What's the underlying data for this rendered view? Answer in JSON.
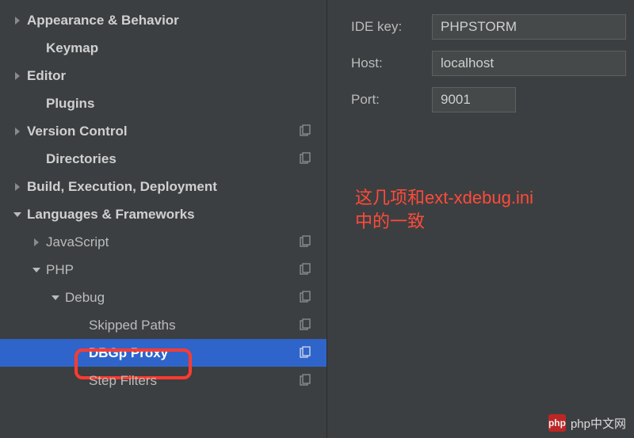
{
  "sidebar": {
    "items": [
      {
        "label": "Appearance & Behavior",
        "bold": true,
        "indent": 0,
        "arrow": "right",
        "copy": false
      },
      {
        "label": "Keymap",
        "bold": true,
        "indent": 1,
        "arrow": "none",
        "copy": false
      },
      {
        "label": "Editor",
        "bold": true,
        "indent": 0,
        "arrow": "right",
        "copy": false
      },
      {
        "label": "Plugins",
        "bold": true,
        "indent": 1,
        "arrow": "none",
        "copy": false
      },
      {
        "label": "Version Control",
        "bold": true,
        "indent": 0,
        "arrow": "right",
        "copy": true
      },
      {
        "label": "Directories",
        "bold": true,
        "indent": 1,
        "arrow": "none",
        "copy": true
      },
      {
        "label": "Build, Execution, Deployment",
        "bold": true,
        "indent": 0,
        "arrow": "right",
        "copy": false
      },
      {
        "label": "Languages & Frameworks",
        "bold": true,
        "indent": 0,
        "arrow": "down",
        "copy": false
      },
      {
        "label": "JavaScript",
        "bold": false,
        "indent": 1,
        "arrow": "right",
        "copy": true
      },
      {
        "label": "PHP",
        "bold": false,
        "indent": 1,
        "arrow": "down",
        "copy": true
      },
      {
        "label": "Debug",
        "bold": false,
        "indent": 2,
        "arrow": "down",
        "copy": true
      },
      {
        "label": "Skipped Paths",
        "bold": false,
        "indent": 3,
        "arrow": "none",
        "copy": true
      },
      {
        "label": "DBGp Proxy",
        "bold": false,
        "indent": 3,
        "arrow": "none",
        "copy": true,
        "selected": true
      },
      {
        "label": "Step Filters",
        "bold": false,
        "indent": 3,
        "arrow": "none",
        "copy": true
      }
    ]
  },
  "form": {
    "ide_key_label": "IDE key:",
    "ide_key_value": "PHPSTORM",
    "host_label": "Host:",
    "host_value": "localhost",
    "port_label": "Port:",
    "port_value": "9001"
  },
  "annotation": {
    "line1": "这几项和ext-xdebug.ini",
    "line2": "中的一致"
  },
  "watermark": {
    "logo": "php",
    "text": "php中文网"
  }
}
